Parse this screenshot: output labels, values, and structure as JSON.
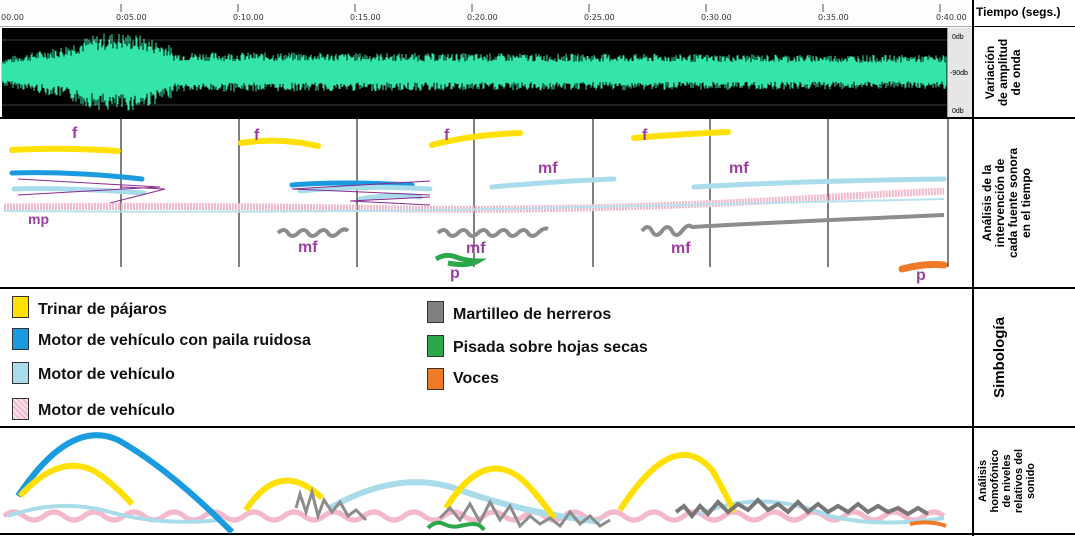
{
  "timeline": {
    "axis_title": "Tiempo (segs.)",
    "ticks": [
      "00.00",
      "0:05.00",
      "0:10.00",
      "0:15.00",
      "0:20.00",
      "0:25.00",
      "0:30.00",
      "0:35.00",
      "0:40.00"
    ]
  },
  "waveform": {
    "db_top": "0db",
    "db_mid": "-90db",
    "db_bottom": "0db",
    "color": "#33e6a8"
  },
  "rows": {
    "amplitude": "Variación\nde amplitud\nde onda",
    "intervention": "Análisis de la\nintervención de\ncada fuente sonora\nen el tiempo",
    "symbology": "Simbología",
    "homophonic": "Análisis\nhomofónico\nde niveles\nrelativos del\nsonido"
  },
  "dynamics": {
    "f1": "f",
    "f2": "f",
    "f3": "f",
    "f4": "f",
    "mp": "mp",
    "mf1": "mf",
    "mf2": "mf",
    "mf3": "mf",
    "mf4": "mf",
    "mf5": "mf",
    "p1": "p",
    "p2": "p"
  },
  "legend": {
    "left": [
      {
        "label": "Trinar de pájaros",
        "color": "#ffe000"
      },
      {
        "label": "Motor de vehículo con paila ruidosa",
        "color": "#1a9be0"
      },
      {
        "label": "Motor de vehículo",
        "color": "#a8dceb"
      },
      {
        "label": "Motor de vehículo",
        "color": "#f3b8cc"
      }
    ],
    "right": [
      {
        "label": "Martilleo de herreros",
        "color": "#808080"
      },
      {
        "label": "Pisada sobre hojas secas",
        "color": "#2aa84a"
      },
      {
        "label": "Voces",
        "color": "#f07a2a"
      }
    ]
  }
}
